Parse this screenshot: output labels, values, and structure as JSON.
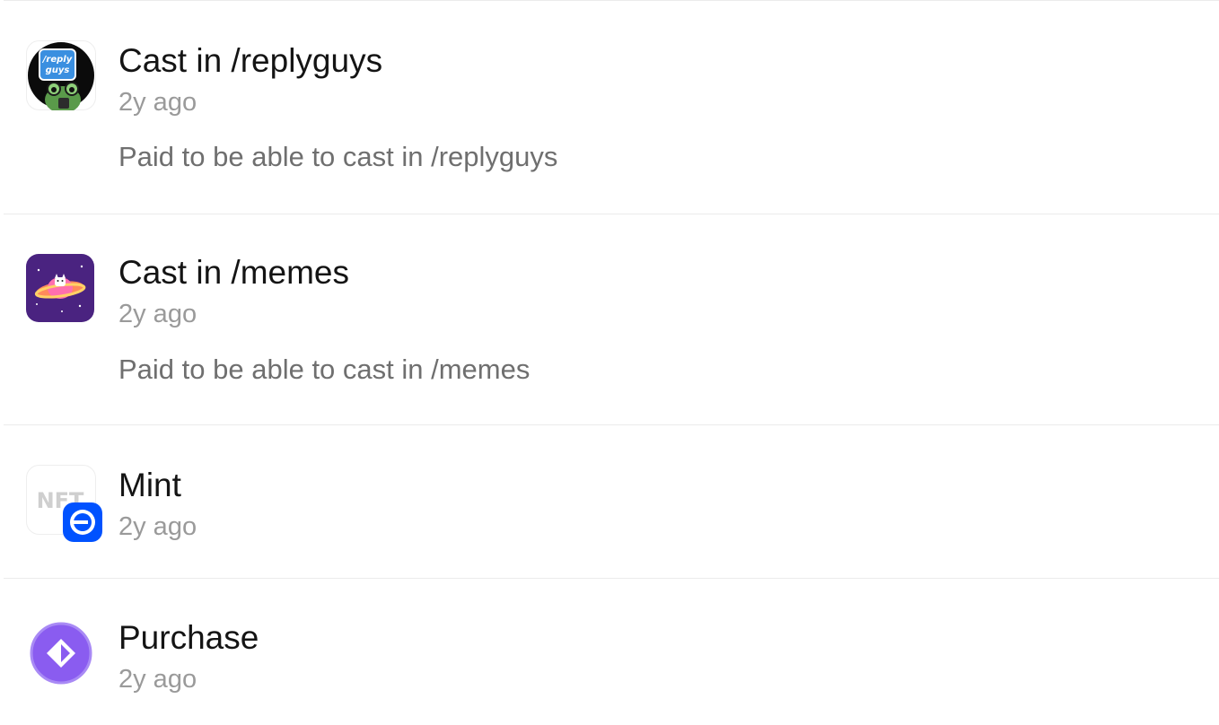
{
  "activity": {
    "items": [
      {
        "title": "Cast in /replyguys",
        "time": "2y ago",
        "description": "Paid to be able to cast in /replyguys",
        "icon": "replyguys-channel-icon",
        "icon_label": "/reply guys"
      },
      {
        "title": "Cast in /memes",
        "time": "2y ago",
        "description": "Paid to be able to cast in /memes",
        "icon": "memes-channel-icon"
      },
      {
        "title": "Mint",
        "time": "2y ago",
        "icon": "nft-icon",
        "icon_label": "NFT",
        "badge": "base-chain-badge"
      },
      {
        "title": "Purchase",
        "time": "2y ago",
        "icon": "purchase-diamond-icon"
      }
    ]
  },
  "colors": {
    "title": "#141414",
    "time": "#9a9a9a",
    "description": "#6f6f6f",
    "divider": "#ebebeb",
    "base_blue": "#0052ff",
    "memes_purple": "#4a2380",
    "purchase_purple": "#8a5cf0"
  }
}
